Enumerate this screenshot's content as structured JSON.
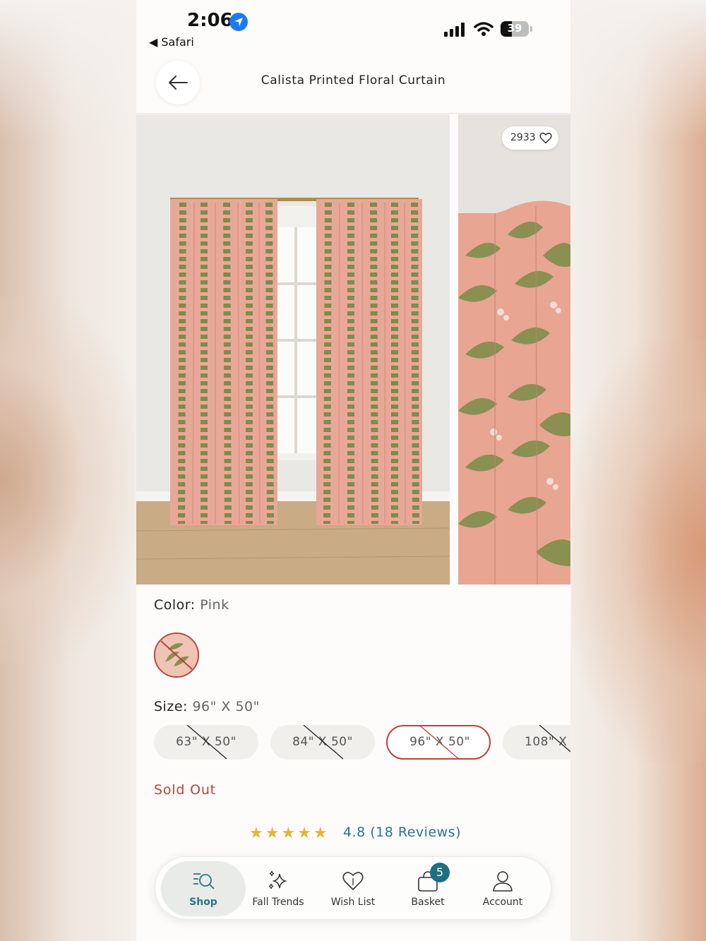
{
  "status_bar": {
    "time": "2:06",
    "back_app": "◀ Safari",
    "battery": "39"
  },
  "header": {
    "title": "Calista Printed Floral Curtain"
  },
  "gallery": {
    "favorite_count": "2933"
  },
  "product": {
    "color_label": "Color:",
    "color_value": "Pink",
    "size_label": "Size:",
    "size_value": "96\" X 50\"",
    "sizes": [
      {
        "label": "63\" X 50\"",
        "selected": false,
        "unavailable": true
      },
      {
        "label": "84\" X 50\"",
        "selected": false,
        "unavailable": true
      },
      {
        "label": "96\" X 50\"",
        "selected": true,
        "unavailable": true
      },
      {
        "label": "108\" X",
        "selected": false,
        "unavailable": true
      }
    ],
    "availability": "Sold Out",
    "stars": "★★★★★",
    "rating_text": "4.8 (18 Reviews)"
  },
  "tabbar": {
    "items": [
      {
        "label": "Shop",
        "icon": "search-list-icon"
      },
      {
        "label": "Fall Trends",
        "icon": "sparkles-icon"
      },
      {
        "label": "Wish List",
        "icon": "heart-icon"
      },
      {
        "label": "Basket",
        "icon": "bag-icon"
      },
      {
        "label": "Account",
        "icon": "user-icon"
      }
    ],
    "basket_count": "5"
  },
  "colors": {
    "accent_red": "#b8443a",
    "accent_teal": "#2c7484",
    "star": "#e6b43a",
    "curtain_pink": "#e8a898",
    "leaf_green": "#7f8a4c"
  }
}
